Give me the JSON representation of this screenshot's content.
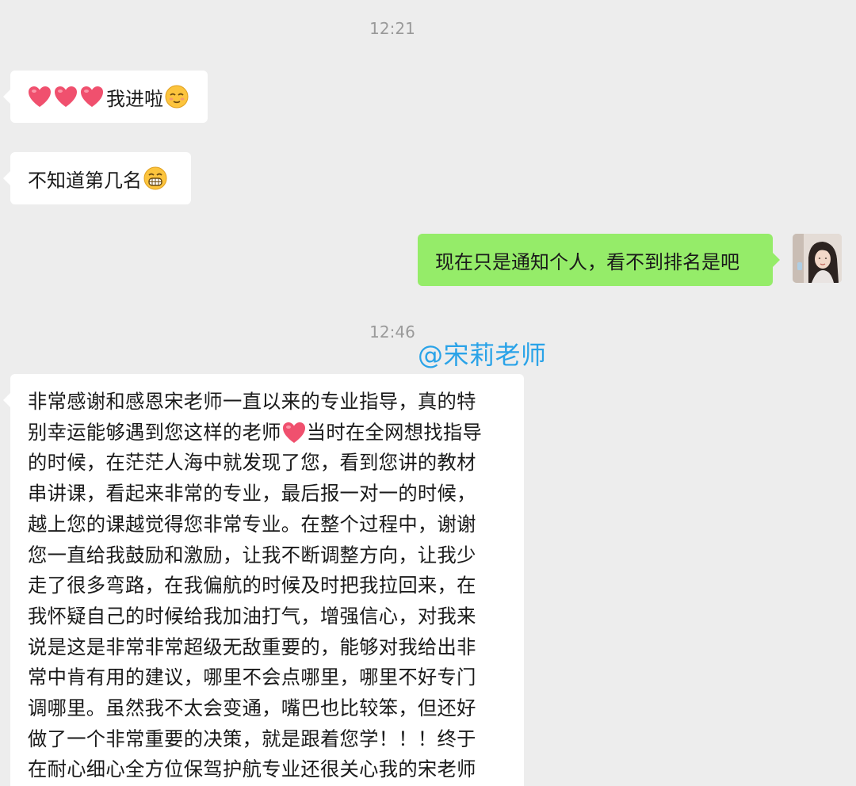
{
  "timestamps": [
    "12:21",
    "12:46"
  ],
  "messages": [
    {
      "side": "left",
      "prefix_icons": [
        "heart-icon",
        "heart-icon",
        "heart-icon"
      ],
      "text": "我进啦",
      "suffix_icon": "relieved-face-icon"
    },
    {
      "side": "left",
      "text": "不知道第几名",
      "suffix_icon": "grinning-face-icon"
    },
    {
      "side": "right",
      "text": "现在只是通知个人，看不到排名是吧"
    },
    {
      "side": "left",
      "lines": [
        "非常感谢和感恩宋老师一直以来的专业指导，真的特",
        "别幸运能够遇到您这样的老师",
        "当时在全网想找指导",
        "的时候，在茫茫人海中就发现了您，看到您讲的教材",
        "串讲课，看起来非常的专业，最后报一对一的时候，",
        "越上您的课越觉得您非常专业。在整个过程中，谢谢",
        "您一直给我鼓励和激励，让我不断调整方向，让我少",
        "走了很多弯路，在我偏航的时候及时把我拉回来，在",
        "我怀疑自己的时候给我加油打气，增强信心，对我来",
        "说是这是非常非常超级无敌重要的，能够对我给出非",
        "常中肯有用的建议，哪里不会点哪里，哪里不好专门",
        "调哪里。虽然我不太会变通，嘴巴也比较笨，但还好",
        "做了一个非常重要的决策，就是跟着您学！！！终于",
        "在耐心细心全方位保驾护航专业还很关心我的宋老师"
      ]
    }
  ],
  "watermark": "@宋莉老师",
  "colors": {
    "background": "#ededed",
    "bubble_in": "#ffffff",
    "bubble_out": "#95ec69",
    "heart": "#f0506e",
    "watermark": "#2aa3e8",
    "timestamp": "#9a9a9a"
  }
}
